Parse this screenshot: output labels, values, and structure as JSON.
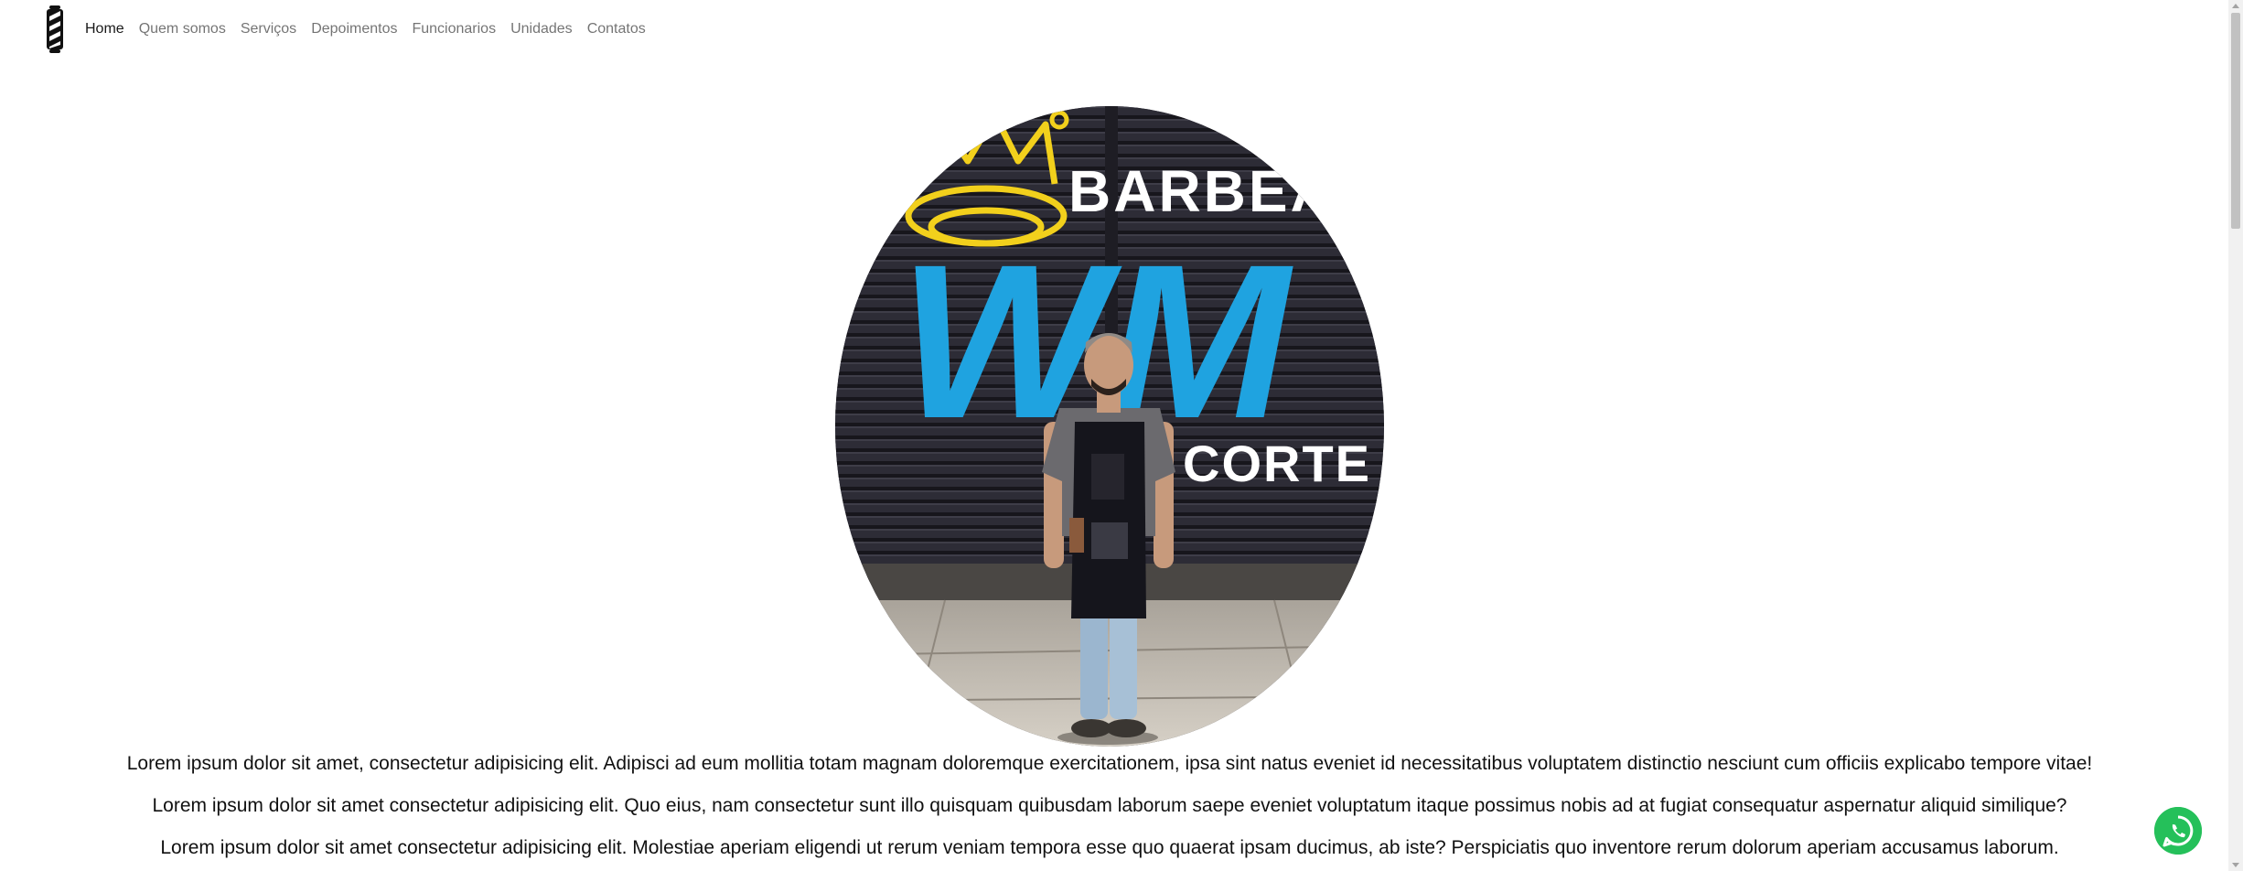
{
  "nav": {
    "brand_icon": "barber-pole-icon",
    "links": [
      {
        "label": "Home",
        "active": true
      },
      {
        "label": "Quem somos",
        "active": false
      },
      {
        "label": "Serviços",
        "active": false
      },
      {
        "label": "Depoimentos",
        "active": false
      },
      {
        "label": "Funcionarios",
        "active": false
      },
      {
        "label": "Unidades",
        "active": false
      },
      {
        "label": "Contatos",
        "active": false
      }
    ]
  },
  "hero": {
    "image_subject": "barber standing in front of graffiti shop shutter",
    "shutter_text_top": "BARBEAR",
    "shutter_text_logo": "WM",
    "shutter_text_bottom": "CORTE"
  },
  "paragraphs": [
    "Lorem ipsum dolor sit amet, consectetur adipisicing elit. Adipisci ad eum mollitia totam magnam doloremque exercitationem, ipsa sint natus eveniet id necessitatibus voluptatem distinctio nesciunt cum officiis explicabo tempore vitae!",
    "Lorem ipsum dolor sit amet consectetur adipisicing elit. Quo eius, nam consectetur sunt illo quisquam quibusdam laborum saepe eveniet voluptatum itaque possimus nobis ad at fugiat consequatur aspernatur aliquid similique?",
    "Lorem ipsum dolor sit amet consectetur adipisicing elit. Molestiae aperiam eligendi ut rerum veniam tempora esse quo quaerat ipsam ducimus, ab iste? Perspiciatis quo inventore rerum dolorum aperiam accusamus laborum."
  ],
  "floating": {
    "icon": "whatsapp-icon",
    "color": "#25c05a"
  },
  "colors": {
    "nav_active": "#1a1a1a",
    "nav_inactive": "#737373",
    "graffiti_blue": "#1fa3e0",
    "graffiti_yellow": "#f2d01c"
  }
}
